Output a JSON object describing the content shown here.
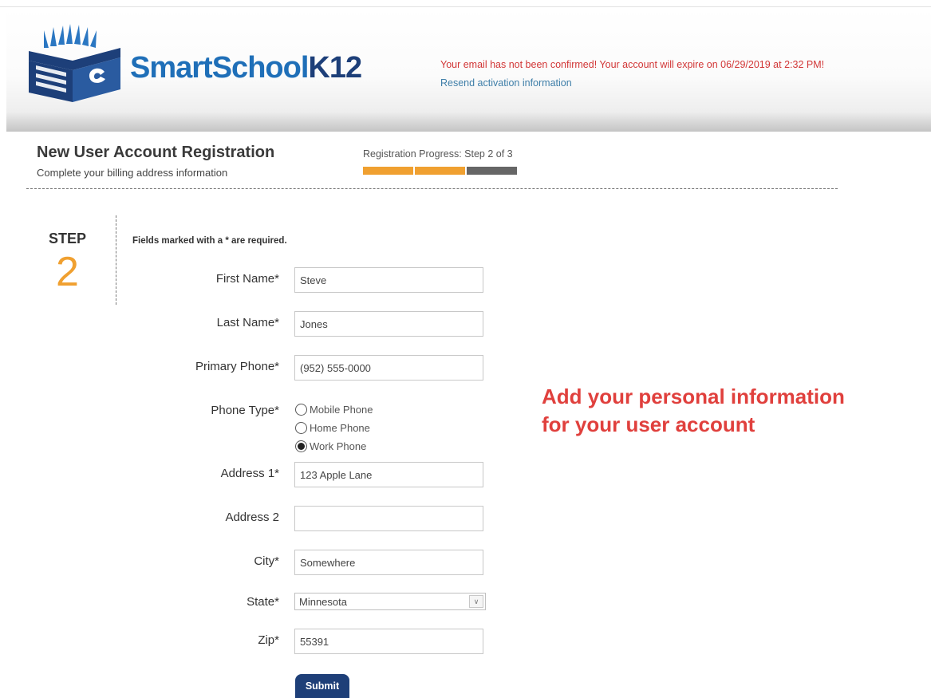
{
  "header": {
    "logo_text_main": "SmartSchool",
    "logo_text_k12": "K12",
    "warning": "Your email has not been confirmed! Your account will expire on 06/29/2019 at 2:32 PM!",
    "resend_link": "Resend activation information"
  },
  "page": {
    "title": "New User Account Registration",
    "subtitle": "Complete your billing address information",
    "progress_label": "Registration Progress: Step 2 of 3",
    "progress": {
      "current_step": 2,
      "total_steps": 3
    },
    "progress_colors": [
      "#f0a030",
      "#f0a030",
      "#666666"
    ]
  },
  "step": {
    "label": "STEP",
    "number": "2"
  },
  "form": {
    "required_note": "Fields marked with a * are required.",
    "first_name": {
      "label": "First Name*",
      "value": "Steve"
    },
    "last_name": {
      "label": "Last Name*",
      "value": "Jones"
    },
    "primary_phone": {
      "label": "Primary Phone*",
      "value": "(952) 555-0000"
    },
    "phone_type": {
      "label": "Phone Type*",
      "options": [
        "Mobile Phone",
        "Home Phone",
        "Work Phone"
      ],
      "selected": "Work Phone"
    },
    "address1": {
      "label": "Address 1*",
      "value": "123 Apple Lane"
    },
    "address2": {
      "label": "Address 2",
      "value": ""
    },
    "city": {
      "label": "City*",
      "value": "Somewhere"
    },
    "state": {
      "label": "State*",
      "value": "Minnesota"
    },
    "zip": {
      "label": "Zip*",
      "value": "55391"
    },
    "submit_label": "Submit"
  },
  "callout": "Add your personal information for your user account",
  "colors": {
    "brand_blue": "#1f6fb8",
    "brand_navy": "#1d3f79",
    "warning_red": "#d23737",
    "link_blue": "#3e7ea8",
    "accent_orange": "#f0a030",
    "callout_red": "#e0403d",
    "submit_bg": "#1e3f78"
  },
  "icons": [
    "book-logo-icon",
    "chevron-down-icon"
  ]
}
